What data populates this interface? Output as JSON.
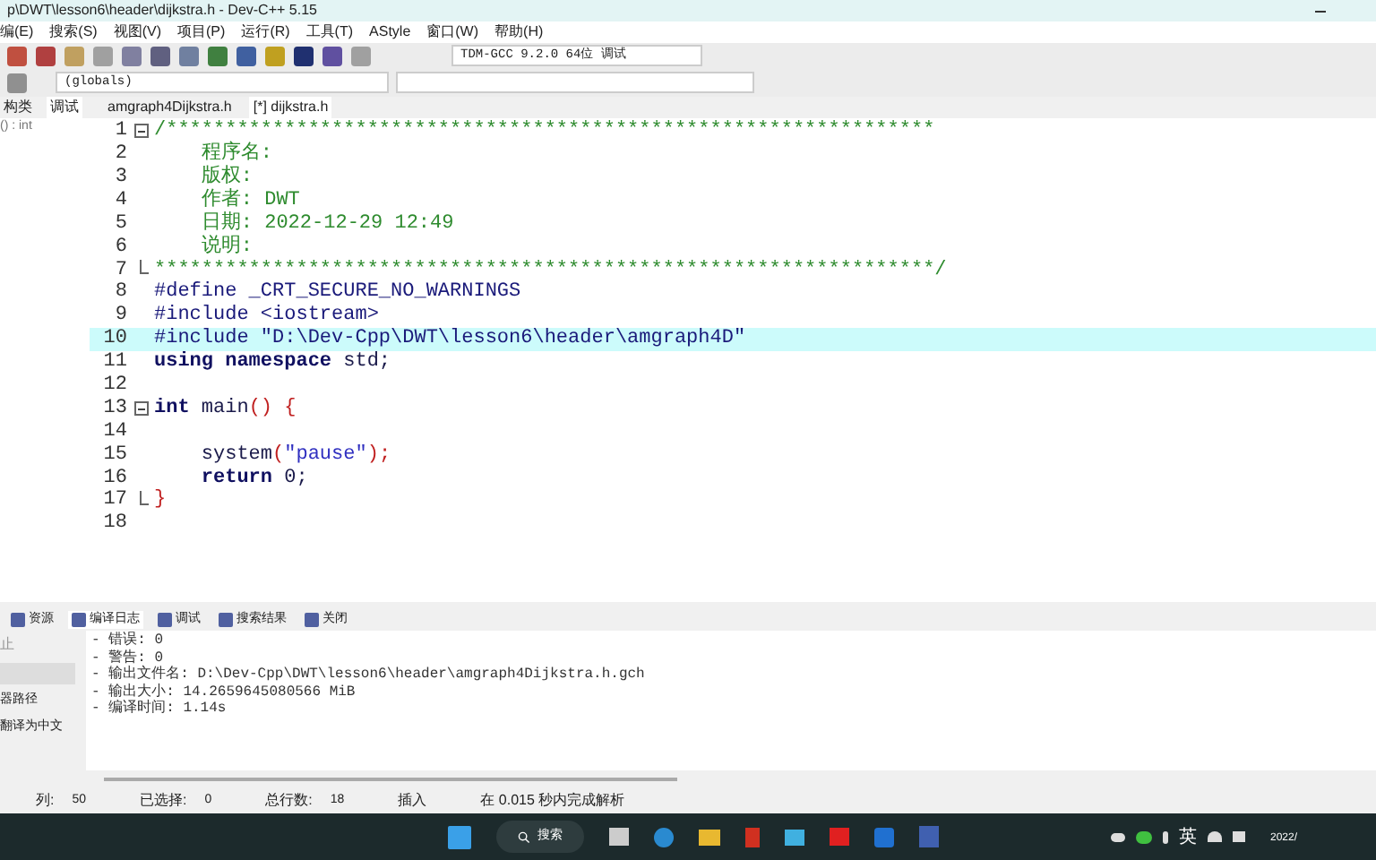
{
  "window": {
    "title": "p\\DWT\\lesson6\\header\\dijkstra.h - Dev-C++ 5.15"
  },
  "menu": [
    "编(E)",
    "搜索(S)",
    "视图(V)",
    "项目(P)",
    "运行(R)",
    "工具(T)",
    "AStyle",
    "窗口(W)",
    "帮助(H)"
  ],
  "compiler_select": {
    "value": "TDM-GCC 9.2.0 64位 调试"
  },
  "scope_select": {
    "value": "(globals)"
  },
  "left_panel": {
    "tabs": [
      {
        "label": "构类",
        "selected": false
      },
      {
        "label": "调试",
        "selected": true
      }
    ],
    "items": [
      "() : int"
    ]
  },
  "editor_tabs": [
    {
      "label": "amgraph4Dijkstra.h",
      "selected": false
    },
    {
      "label": "[*] dijkstra.h",
      "selected": true
    }
  ],
  "code_lines": [
    {
      "number": "1",
      "fold_start": true,
      "fold_end": false,
      "highlighted": false,
      "tokens": [
        {
          "kind": "comment",
          "text": "/*****************************************************************"
        }
      ]
    },
    {
      "number": "2",
      "fold_start": false,
      "fold_end": false,
      "highlighted": false,
      "tokens": [
        {
          "kind": "comment",
          "text": "    程序名:"
        }
      ]
    },
    {
      "number": "3",
      "fold_start": false,
      "fold_end": false,
      "highlighted": false,
      "tokens": [
        {
          "kind": "comment",
          "text": "    版权:"
        }
      ]
    },
    {
      "number": "4",
      "fold_start": false,
      "fold_end": false,
      "highlighted": false,
      "tokens": [
        {
          "kind": "comment",
          "text": "    作者: DWT"
        }
      ]
    },
    {
      "number": "5",
      "fold_start": false,
      "fold_end": false,
      "highlighted": false,
      "tokens": [
        {
          "kind": "comment",
          "text": "    日期: 2022-12-29 12:49"
        }
      ]
    },
    {
      "number": "6",
      "fold_start": false,
      "fold_end": false,
      "highlighted": false,
      "tokens": [
        {
          "kind": "comment",
          "text": "    说明:"
        }
      ]
    },
    {
      "number": "7",
      "fold_start": false,
      "fold_end": true,
      "highlighted": false,
      "tokens": [
        {
          "kind": "comment",
          "text": "******************************************************************/"
        }
      ]
    },
    {
      "number": "8",
      "fold_start": false,
      "fold_end": false,
      "highlighted": false,
      "tokens": [
        {
          "kind": "preproc",
          "text": "#define _CRT_SECURE_NO_WARNINGS"
        }
      ]
    },
    {
      "number": "9",
      "fold_start": false,
      "fold_end": false,
      "highlighted": false,
      "tokens": [
        {
          "kind": "preproc",
          "text": "#include <iostream>"
        }
      ]
    },
    {
      "number": "10",
      "fold_start": false,
      "fold_end": false,
      "highlighted": true,
      "tokens": [
        {
          "kind": "preproc",
          "text": "#include \"D:\\Dev-Cpp\\DWT\\lesson6\\header\\amgraph4D\""
        }
      ]
    },
    {
      "number": "11",
      "fold_start": false,
      "fold_end": false,
      "highlighted": false,
      "tokens": [
        {
          "kind": "keyword",
          "text": "using namespace"
        },
        {
          "kind": "plain",
          "text": " std;"
        }
      ]
    },
    {
      "number": "12",
      "fold_start": false,
      "fold_end": false,
      "highlighted": false
    },
    {
      "number": "13",
      "fold_start": true,
      "fold_end": false,
      "highlighted": false,
      "tokens": [
        {
          "kind": "keyword",
          "text": "int"
        },
        {
          "kind": "plain",
          "text": " main"
        },
        {
          "kind": "symbol",
          "text": "() {"
        }
      ]
    },
    {
      "number": "14",
      "fold_start": false,
      "fold_end": false,
      "highlighted": false
    },
    {
      "number": "15",
      "fold_start": false,
      "fold_end": false,
      "highlighted": false,
      "tokens": [
        {
          "kind": "plain",
          "text": "    system"
        },
        {
          "kind": "symbol",
          "text": "("
        },
        {
          "kind": "string",
          "text": "\"pause\""
        },
        {
          "kind": "symbol",
          "text": ");"
        }
      ]
    },
    {
      "number": "16",
      "fold_start": false,
      "fold_end": false,
      "highlighted": false,
      "tokens": [
        {
          "kind": "keyword",
          "text": "    return"
        },
        {
          "kind": "plain",
          "text": " 0;"
        }
      ]
    },
    {
      "number": "17",
      "fold_start": false,
      "fold_end": true,
      "highlighted": false,
      "tokens": [
        {
          "kind": "symbol",
          "text": "}"
        }
      ]
    },
    {
      "number": "18",
      "fold_start": false,
      "fold_end": false,
      "highlighted": false
    }
  ],
  "bottom_tabs": [
    {
      "label": "资源",
      "selected": false
    },
    {
      "label": "编译日志",
      "selected": true
    },
    {
      "label": "调试",
      "selected": false
    },
    {
      "label": "搜索结果",
      "selected": false
    },
    {
      "label": "关闭",
      "selected": false
    }
  ],
  "bottom_left": {
    "abort_button": "止",
    "options": [
      "器路径",
      "翻译为中文"
    ]
  },
  "compile_log": [
    "- 错误: 0",
    "- 警告: 0",
    "- 输出文件名: D:\\Dev-Cpp\\DWT\\lesson6\\header\\amgraph4Dijkstra.h.gch",
    "- 输出大小: 14.2659645080566 MiB",
    "- 编译时间: 1.14s"
  ],
  "status_bar": [
    {
      "label": "列:",
      "value": "50"
    },
    {
      "label": "已选择:",
      "value": "0"
    },
    {
      "label": "总行数:",
      "value": "18"
    },
    {
      "label": "插入"
    },
    {
      "label": "在 0.015 秒内完成解析"
    }
  ],
  "taskbar": {
    "search": "搜索",
    "input_method": "英",
    "clock": "2022/"
  }
}
